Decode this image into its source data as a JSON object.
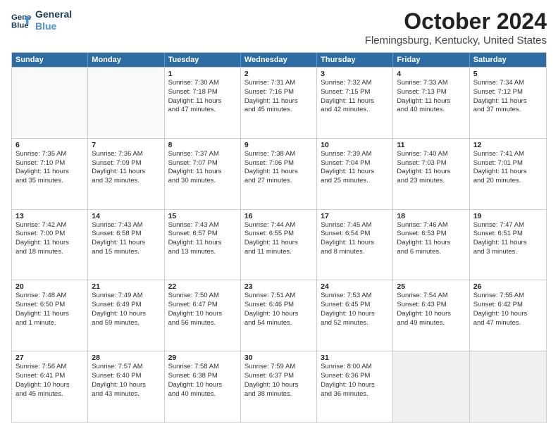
{
  "header": {
    "logo_line1": "General",
    "logo_line2": "Blue",
    "title": "October 2024",
    "subtitle": "Flemingsburg, Kentucky, United States"
  },
  "weekdays": [
    "Sunday",
    "Monday",
    "Tuesday",
    "Wednesday",
    "Thursday",
    "Friday",
    "Saturday"
  ],
  "rows": [
    [
      {
        "day": "",
        "lines": [],
        "empty": true
      },
      {
        "day": "",
        "lines": [],
        "empty": true
      },
      {
        "day": "1",
        "lines": [
          "Sunrise: 7:30 AM",
          "Sunset: 7:18 PM",
          "Daylight: 11 hours",
          "and 47 minutes."
        ]
      },
      {
        "day": "2",
        "lines": [
          "Sunrise: 7:31 AM",
          "Sunset: 7:16 PM",
          "Daylight: 11 hours",
          "and 45 minutes."
        ]
      },
      {
        "day": "3",
        "lines": [
          "Sunrise: 7:32 AM",
          "Sunset: 7:15 PM",
          "Daylight: 11 hours",
          "and 42 minutes."
        ]
      },
      {
        "day": "4",
        "lines": [
          "Sunrise: 7:33 AM",
          "Sunset: 7:13 PM",
          "Daylight: 11 hours",
          "and 40 minutes."
        ]
      },
      {
        "day": "5",
        "lines": [
          "Sunrise: 7:34 AM",
          "Sunset: 7:12 PM",
          "Daylight: 11 hours",
          "and 37 minutes."
        ]
      }
    ],
    [
      {
        "day": "6",
        "lines": [
          "Sunrise: 7:35 AM",
          "Sunset: 7:10 PM",
          "Daylight: 11 hours",
          "and 35 minutes."
        ]
      },
      {
        "day": "7",
        "lines": [
          "Sunrise: 7:36 AM",
          "Sunset: 7:09 PM",
          "Daylight: 11 hours",
          "and 32 minutes."
        ]
      },
      {
        "day": "8",
        "lines": [
          "Sunrise: 7:37 AM",
          "Sunset: 7:07 PM",
          "Daylight: 11 hours",
          "and 30 minutes."
        ]
      },
      {
        "day": "9",
        "lines": [
          "Sunrise: 7:38 AM",
          "Sunset: 7:06 PM",
          "Daylight: 11 hours",
          "and 27 minutes."
        ]
      },
      {
        "day": "10",
        "lines": [
          "Sunrise: 7:39 AM",
          "Sunset: 7:04 PM",
          "Daylight: 11 hours",
          "and 25 minutes."
        ]
      },
      {
        "day": "11",
        "lines": [
          "Sunrise: 7:40 AM",
          "Sunset: 7:03 PM",
          "Daylight: 11 hours",
          "and 23 minutes."
        ]
      },
      {
        "day": "12",
        "lines": [
          "Sunrise: 7:41 AM",
          "Sunset: 7:01 PM",
          "Daylight: 11 hours",
          "and 20 minutes."
        ]
      }
    ],
    [
      {
        "day": "13",
        "lines": [
          "Sunrise: 7:42 AM",
          "Sunset: 7:00 PM",
          "Daylight: 11 hours",
          "and 18 minutes."
        ]
      },
      {
        "day": "14",
        "lines": [
          "Sunrise: 7:43 AM",
          "Sunset: 6:58 PM",
          "Daylight: 11 hours",
          "and 15 minutes."
        ]
      },
      {
        "day": "15",
        "lines": [
          "Sunrise: 7:43 AM",
          "Sunset: 6:57 PM",
          "Daylight: 11 hours",
          "and 13 minutes."
        ]
      },
      {
        "day": "16",
        "lines": [
          "Sunrise: 7:44 AM",
          "Sunset: 6:55 PM",
          "Daylight: 11 hours",
          "and 11 minutes."
        ]
      },
      {
        "day": "17",
        "lines": [
          "Sunrise: 7:45 AM",
          "Sunset: 6:54 PM",
          "Daylight: 11 hours",
          "and 8 minutes."
        ]
      },
      {
        "day": "18",
        "lines": [
          "Sunrise: 7:46 AM",
          "Sunset: 6:53 PM",
          "Daylight: 11 hours",
          "and 6 minutes."
        ]
      },
      {
        "day": "19",
        "lines": [
          "Sunrise: 7:47 AM",
          "Sunset: 6:51 PM",
          "Daylight: 11 hours",
          "and 3 minutes."
        ]
      }
    ],
    [
      {
        "day": "20",
        "lines": [
          "Sunrise: 7:48 AM",
          "Sunset: 6:50 PM",
          "Daylight: 11 hours",
          "and 1 minute."
        ]
      },
      {
        "day": "21",
        "lines": [
          "Sunrise: 7:49 AM",
          "Sunset: 6:49 PM",
          "Daylight: 10 hours",
          "and 59 minutes."
        ]
      },
      {
        "day": "22",
        "lines": [
          "Sunrise: 7:50 AM",
          "Sunset: 6:47 PM",
          "Daylight: 10 hours",
          "and 56 minutes."
        ]
      },
      {
        "day": "23",
        "lines": [
          "Sunrise: 7:51 AM",
          "Sunset: 6:46 PM",
          "Daylight: 10 hours",
          "and 54 minutes."
        ]
      },
      {
        "day": "24",
        "lines": [
          "Sunrise: 7:53 AM",
          "Sunset: 6:45 PM",
          "Daylight: 10 hours",
          "and 52 minutes."
        ]
      },
      {
        "day": "25",
        "lines": [
          "Sunrise: 7:54 AM",
          "Sunset: 6:43 PM",
          "Daylight: 10 hours",
          "and 49 minutes."
        ]
      },
      {
        "day": "26",
        "lines": [
          "Sunrise: 7:55 AM",
          "Sunset: 6:42 PM",
          "Daylight: 10 hours",
          "and 47 minutes."
        ]
      }
    ],
    [
      {
        "day": "27",
        "lines": [
          "Sunrise: 7:56 AM",
          "Sunset: 6:41 PM",
          "Daylight: 10 hours",
          "and 45 minutes."
        ]
      },
      {
        "day": "28",
        "lines": [
          "Sunrise: 7:57 AM",
          "Sunset: 6:40 PM",
          "Daylight: 10 hours",
          "and 43 minutes."
        ]
      },
      {
        "day": "29",
        "lines": [
          "Sunrise: 7:58 AM",
          "Sunset: 6:38 PM",
          "Daylight: 10 hours",
          "and 40 minutes."
        ]
      },
      {
        "day": "30",
        "lines": [
          "Sunrise: 7:59 AM",
          "Sunset: 6:37 PM",
          "Daylight: 10 hours",
          "and 38 minutes."
        ]
      },
      {
        "day": "31",
        "lines": [
          "Sunrise: 8:00 AM",
          "Sunset: 6:36 PM",
          "Daylight: 10 hours",
          "and 36 minutes."
        ]
      },
      {
        "day": "",
        "lines": [],
        "empty": true,
        "shaded": true
      },
      {
        "day": "",
        "lines": [],
        "empty": true,
        "shaded": true
      }
    ]
  ]
}
